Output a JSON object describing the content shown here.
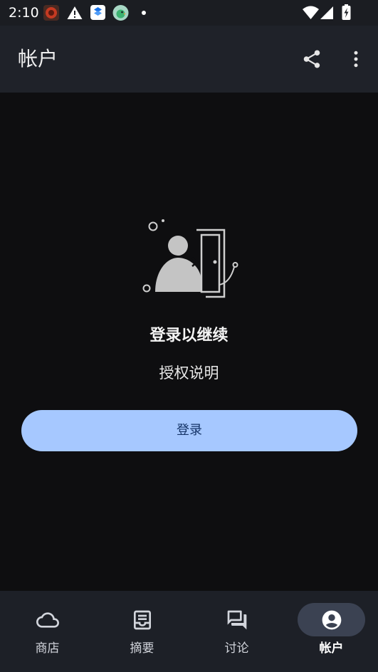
{
  "status_bar": {
    "time": "2:10",
    "notification_icons": [
      "app-notification-icon",
      "warning-icon",
      "layers-app-icon",
      "bird-app-icon",
      "more-notifications-dot-icon"
    ],
    "system_icons": [
      "wifi-icon",
      "cellular-signal-icon",
      "battery-charging-icon"
    ]
  },
  "app_bar": {
    "title": "帐户",
    "actions": [
      {
        "name": "share",
        "icon": "share-icon"
      },
      {
        "name": "more",
        "icon": "more-vert-icon"
      }
    ]
  },
  "empty_state": {
    "illustration": "login-door-illustration",
    "title": "登录以继续",
    "subtitle": "授权说明"
  },
  "login_button": {
    "label": "登录"
  },
  "bottom_nav": {
    "items": [
      {
        "label": "商店",
        "icon": "cloud-icon",
        "selected": false
      },
      {
        "label": "摘要",
        "icon": "article-icon",
        "selected": false
      },
      {
        "label": "讨论",
        "icon": "forum-icon",
        "selected": false
      },
      {
        "label": "帐户",
        "icon": "account-circle-icon",
        "selected": true
      }
    ]
  },
  "colors": {
    "background": "#0e0e10",
    "status_bar": "#1b1d22",
    "app_bar": "#1f2229",
    "bottom_nav": "#1d2027",
    "button": "#a6c8ff",
    "button_text": "#153467",
    "selected_indicator": "#3b4252",
    "text": "#f1f1f1"
  }
}
